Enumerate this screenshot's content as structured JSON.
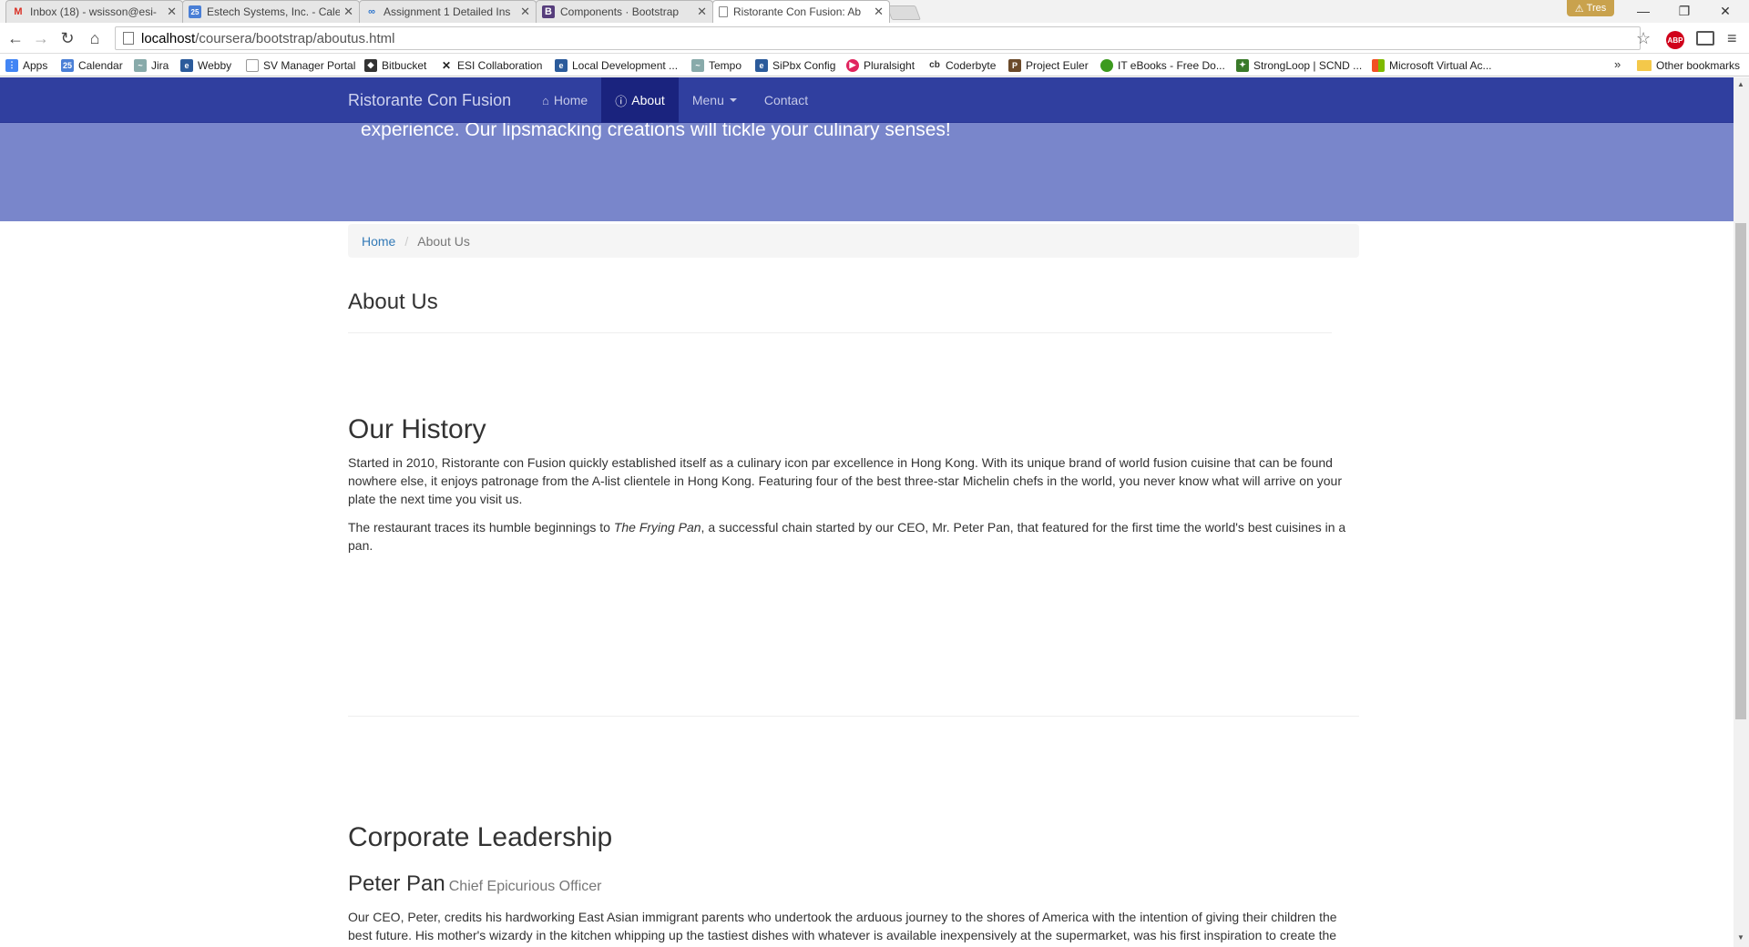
{
  "browser": {
    "tabs": [
      {
        "title": "Inbox (18) - wsisson@esi-",
        "icon": "gmail-icon",
        "active": false
      },
      {
        "title": "Estech Systems, Inc. - Cale",
        "icon": "calendar-icon",
        "active": false
      },
      {
        "title": "Assignment 1 Detailed Ins",
        "icon": "coursera-icon",
        "active": false
      },
      {
        "title": "Components · Bootstrap",
        "icon": "bootstrap-icon",
        "active": false
      },
      {
        "title": "Ristorante Con Fusion: Ab",
        "icon": "page-icon",
        "active": true
      }
    ],
    "profile_name": "Tres",
    "url_host": "localhost",
    "url_path": "/coursera/bootstrap/aboutus.html",
    "bookmarks": [
      {
        "label": "Apps",
        "color": "#4285f4"
      },
      {
        "label": "Calendar",
        "color": "#4a7fd6"
      },
      {
        "label": "Jira",
        "color": "#8aa"
      },
      {
        "label": "Webby",
        "color": "#2b5b9b"
      },
      {
        "label": "SV Manager Portal",
        "color": "#999"
      },
      {
        "label": "Bitbucket",
        "color": "#333"
      },
      {
        "label": "ESI Collaboration",
        "color": "#222"
      },
      {
        "label": "Local Development ...",
        "color": "#2b5b9b"
      },
      {
        "label": "Tempo",
        "color": "#8aa"
      },
      {
        "label": "SiPbx Config",
        "color": "#2b5b9b"
      },
      {
        "label": "Pluralsight",
        "color": "#e0245e"
      },
      {
        "label": "Coderbyte",
        "color": "#555"
      },
      {
        "label": "Project Euler",
        "color": "#6b4a2a"
      },
      {
        "label": "IT eBooks - Free Do...",
        "color": "#3c9a1e"
      },
      {
        "label": "StrongLoop | SCND ...",
        "color": "#3a7a2a"
      },
      {
        "label": "Microsoft Virtual Ac...",
        "color": "#f25022"
      }
    ],
    "other_bookmarks": "Other bookmarks",
    "abp_label": "ABP"
  },
  "site": {
    "brand": "Ristorante Con Fusion",
    "nav": {
      "home": "Home",
      "about": "About",
      "menu": "Menu",
      "contact": "Contact"
    },
    "jumbotron_text": "experience. Our lipsmacking creations will tickle your culinary senses!",
    "breadcrumb": {
      "home": "Home",
      "current": "About Us"
    },
    "about_heading": "About Us",
    "history_heading": "Our History",
    "history_p1": "Started in 2010, Ristorante con Fusion quickly established itself as a culinary icon par excellence in Hong Kong. With its unique brand of world fusion cuisine that can be found nowhere else, it enjoys patronage from the A-list clientele in Hong Kong. Featuring four of the best three-star Michelin chefs in the world, you never know what will arrive on your plate the next time you visit us.",
    "history_p2_before": "The restaurant traces its humble beginnings to ",
    "history_p2_italic": "The Frying Pan",
    "history_p2_after": ", a successful chain started by our CEO, Mr. Peter Pan, that featured for the first time the world's best cuisines in a pan.",
    "leadership_heading": "Corporate Leadership",
    "leader_name": "Peter Pan",
    "leader_title": "Chief Epicurious Officer",
    "leader_bio": "Our CEO, Peter, credits his hardworking East Asian immigrant parents who undertook the arduous journey to the shores of America with the intention of giving their children the best future. His mother's wizardy in the kitchen whipping up the tastiest dishes with whatever is available inexpensively at the supermarket, was his first inspiration to create the"
  }
}
